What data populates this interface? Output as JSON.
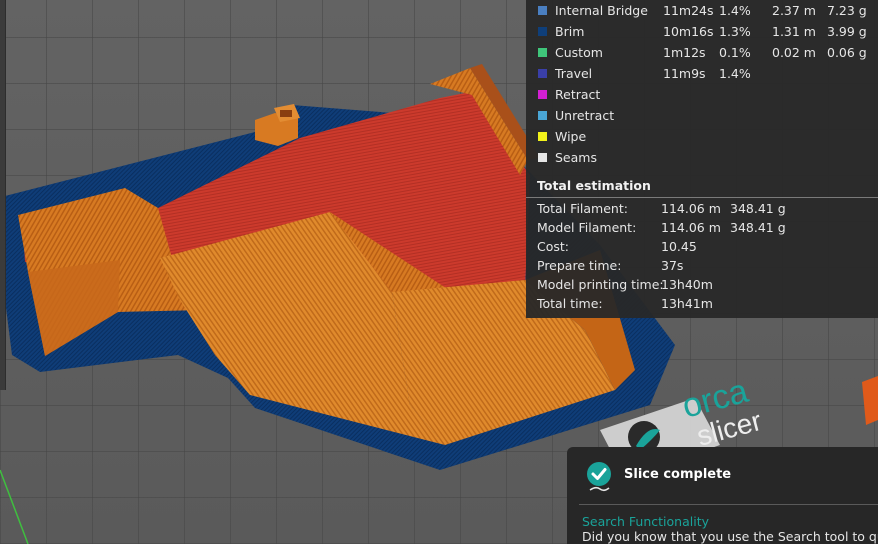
{
  "stats": {
    "legend": [
      {
        "name": "Internal Bridge",
        "time": "11m24s",
        "percent": "1.4%",
        "length": "2.37 m",
        "weight": "7.23 g",
        "color": "#4a7fc1"
      },
      {
        "name": "Brim",
        "time": "10m16s",
        "percent": "1.3%",
        "length": "1.31 m",
        "weight": "3.99 g",
        "color": "#0f3f7a"
      },
      {
        "name": "Custom",
        "time": "1m12s",
        "percent": "0.1%",
        "length": "0.02 m",
        "weight": "0.06 g",
        "color": "#3fc67a"
      },
      {
        "name": "Travel",
        "time": "11m9s",
        "percent": "1.4%",
        "length": "",
        "weight": "",
        "color": "#3a3fa8"
      },
      {
        "name": "Retract",
        "time": "",
        "percent": "",
        "length": "",
        "weight": "",
        "color": "#d21fd2"
      },
      {
        "name": "Unretract",
        "time": "",
        "percent": "",
        "length": "",
        "weight": "",
        "color": "#4aa6d6"
      },
      {
        "name": "Wipe",
        "time": "",
        "percent": "",
        "length": "",
        "weight": "",
        "color": "#f2f21a"
      },
      {
        "name": "Seams",
        "time": "",
        "percent": "",
        "length": "",
        "weight": "",
        "color": "#e6e6e6"
      }
    ],
    "total_title": "Total estimation",
    "totals": [
      {
        "label": "Total Filament:",
        "value": "114.06 m",
        "value2": "348.41 g"
      },
      {
        "label": "Model Filament:",
        "value": "114.06 m",
        "value2": "348.41 g"
      },
      {
        "label": "Cost:",
        "value": "10.45",
        "value2": ""
      },
      {
        "label": "Prepare time:",
        "value": "37s",
        "value2": ""
      },
      {
        "label": "Model printing time:",
        "value": "13h40m",
        "value2": ""
      },
      {
        "label": "Total time:",
        "value": "13h41m",
        "value2": ""
      }
    ]
  },
  "plate_logo": {
    "line1": "orca",
    "line2": "slicer"
  },
  "notification": {
    "title": "Slice complete",
    "hint_title": "Search Functionality",
    "hint_body": "Did you know that you use the Search tool to quickly"
  },
  "icons": {
    "slice": "check-circle-icon",
    "plate_logo": "orca-logo-icon"
  },
  "colors": {
    "brim": "#0f3f7a",
    "roof": "#cf3a2c",
    "wall": "#d9761f",
    "accent": "#1aa39a"
  }
}
